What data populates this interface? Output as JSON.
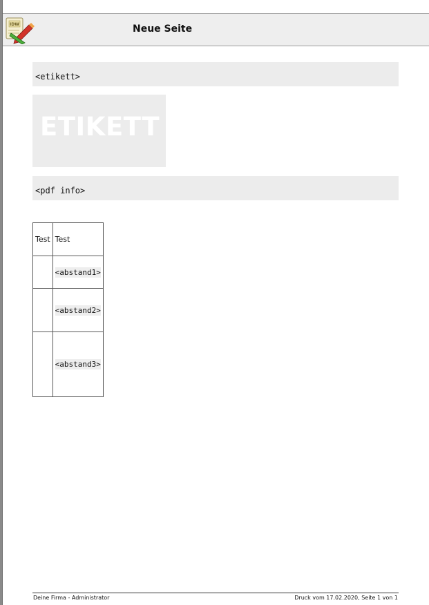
{
  "header": {
    "title": "Neue Seite",
    "logo": {
      "icon": "idw-app-logo",
      "text": "IDW"
    }
  },
  "content": {
    "etikett_field": "<etikett>",
    "etikett_label": "ETIKETT",
    "pdf_info_field": "<pdf info>"
  },
  "table": {
    "header": [
      "Test",
      "Test"
    ],
    "rows": [
      {
        "col1": "",
        "col2": "<abstand1>"
      },
      {
        "col1": "",
        "col2": "<abstand2>"
      },
      {
        "col1": "",
        "col2": "<abstand3>"
      }
    ]
  },
  "footer": {
    "left": "Deine Firma - Administrator",
    "right": "Druck vom 17.02.2020, Seite 1 von 1"
  },
  "colors": {
    "header_bg": "#eeeeee",
    "field_bg": "#ececec",
    "etikett_text": "#ffffff"
  }
}
